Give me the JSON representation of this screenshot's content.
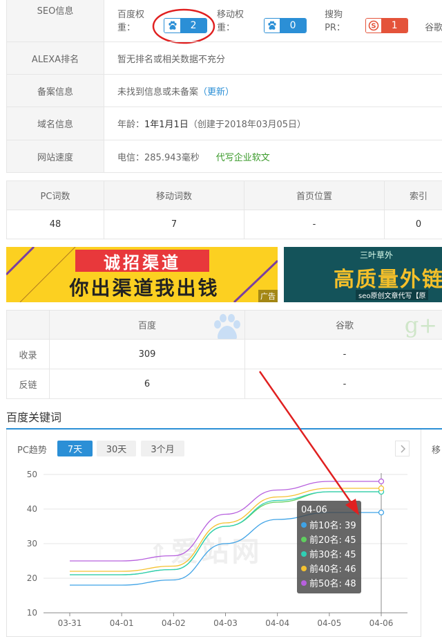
{
  "seo": {
    "label": "SEO信息",
    "baidu_weight_label": "百度权重：",
    "baidu_weight": "2",
    "mobile_weight_label": "移动权重：",
    "mobile_weight": "0",
    "sogou_pr_label": "搜狗PR：",
    "sogou_pr": "1",
    "google_pr_label": "谷歌P"
  },
  "alexa": {
    "label": "ALEXA排名",
    "value": "暂无排名或相关数据不充分"
  },
  "icp": {
    "label": "备案信息",
    "value": "未找到信息或未备案",
    "update_link": "（更新）"
  },
  "domain": {
    "label": "域名信息",
    "age_label": "年龄：",
    "age": "1年1月1日",
    "created": "（创建于2018年03月05日）"
  },
  "speed": {
    "label": "网站速度",
    "value": "电信：285.943毫秒",
    "ad_link": "代写企业软文"
  },
  "stats": {
    "headers": [
      "PC词数",
      "移动词数",
      "首页位置",
      "索引"
    ],
    "values": [
      "48",
      "7",
      "-",
      "0"
    ]
  },
  "banners": {
    "left_top": "诚招渠道",
    "left_bottom": "你出渠道我出钱",
    "ad_tag": "广告",
    "right_top": "三叶草外",
    "right_main": "高质量外链",
    "right_bottom": "seo原创文章代写【原"
  },
  "index_table": {
    "col_baidu": "百度",
    "col_google": "谷歌",
    "rows": [
      {
        "label": "收录",
        "baidu": "309",
        "google": "-"
      },
      {
        "label": "反链",
        "baidu": "6",
        "google": "-"
      }
    ]
  },
  "keywords": {
    "title": "百度关键词",
    "trend_label": "PC趋势",
    "tabs": [
      "7天",
      "30天",
      "3个月"
    ],
    "active_tab": 0,
    "next_icon": "chevron-right-icon",
    "right_panel_label": "移",
    "watermark": "爱站网"
  },
  "chart_data": {
    "type": "line",
    "x": [
      "03-31",
      "04-01",
      "04-02",
      "04-03",
      "04-04",
      "04-05",
      "04-06"
    ],
    "ylim": [
      10,
      50
    ],
    "yticks": [
      10,
      20,
      30,
      40,
      50
    ],
    "grid": true,
    "series": [
      {
        "name": "前10名",
        "color": "#3fa3e6",
        "values": [
          18,
          18,
          19.5,
          30,
          37,
          39,
          39
        ]
      },
      {
        "name": "前20名",
        "color": "#5fcf5f",
        "values": [
          21,
          21,
          22.5,
          35,
          42,
          45,
          45
        ]
      },
      {
        "name": "前30名",
        "color": "#2fcfb4",
        "values": [
          21,
          21,
          22.5,
          35,
          42.5,
          45,
          45
        ]
      },
      {
        "name": "前40名",
        "color": "#f5c231",
        "values": [
          22,
          22,
          23.5,
          36,
          43.5,
          46,
          46
        ]
      },
      {
        "name": "前50名",
        "color": "#b760de",
        "values": [
          25,
          25,
          26.5,
          38.5,
          45.5,
          48,
          48
        ]
      }
    ],
    "tooltip": {
      "title": "04-06",
      "entries": [
        "前10名: 39",
        "前20名: 45",
        "前30名: 45",
        "前40名: 46",
        "前50名: 48"
      ]
    }
  },
  "colors": {
    "accent_blue": "#2b8fd6",
    "sogou_red": "#e4533a",
    "link_green": "#3a9a2a",
    "annotation_red": "#e02020"
  }
}
